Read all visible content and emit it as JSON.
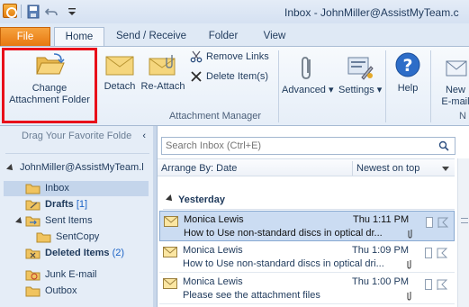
{
  "window": {
    "title": "Inbox - JohnMiller@AssistMyTeam.c"
  },
  "ribbon_tabs": {
    "file": "File",
    "home": "Home",
    "send_receive": "Send / Receive",
    "folder": "Folder",
    "view": "View"
  },
  "ribbon": {
    "change_attachment_folder": [
      "Change",
      "Attachment Folder"
    ],
    "detach": "Detach",
    "reattach": "Re-Attach",
    "remove_links": "Remove Links",
    "delete_items": "Delete Item(s)",
    "group_label": "Attachment Manager",
    "advanced": "Advanced",
    "settings": "Settings",
    "help": "Help",
    "new_email": [
      "New",
      "E-mail"
    ],
    "next_group_label": "N"
  },
  "nav": {
    "favorites_placeholder": "Drag Your Favorite Folde",
    "account": "JohnMiller@AssistMyTeam.l",
    "folders": [
      {
        "name": "Inbox",
        "count": ""
      },
      {
        "name": "Drafts",
        "count": "[1]"
      },
      {
        "name": "Sent Items",
        "count": ""
      },
      {
        "name": "SentCopy",
        "count": ""
      },
      {
        "name": "Deleted Items",
        "count": "(2)"
      },
      {
        "name": "Junk E-mail",
        "count": ""
      },
      {
        "name": "Outbox",
        "count": ""
      }
    ]
  },
  "list": {
    "search_placeholder": "Search Inbox (Ctrl+E)",
    "arrange_by": "Arrange By: Date",
    "sort_order": "Newest on top",
    "group": "Yesterday",
    "messages": [
      {
        "from": "Monica Lewis",
        "time": "Thu 1:11 PM",
        "subject": "How to Use non-standard discs in optical dr..."
      },
      {
        "from": "Monica Lewis",
        "time": "Thu 1:09 PM",
        "subject": "How to Use non-standard discs in optical dri..."
      },
      {
        "from": "Monica Lewis",
        "time": "Thu 1:00 PM",
        "subject": "Please see the attachment files"
      }
    ]
  },
  "colors": {
    "file_tab": "#e6770e",
    "highlight": "#e8101a",
    "selection": "#cbdcf2",
    "text": "#1e395b"
  }
}
